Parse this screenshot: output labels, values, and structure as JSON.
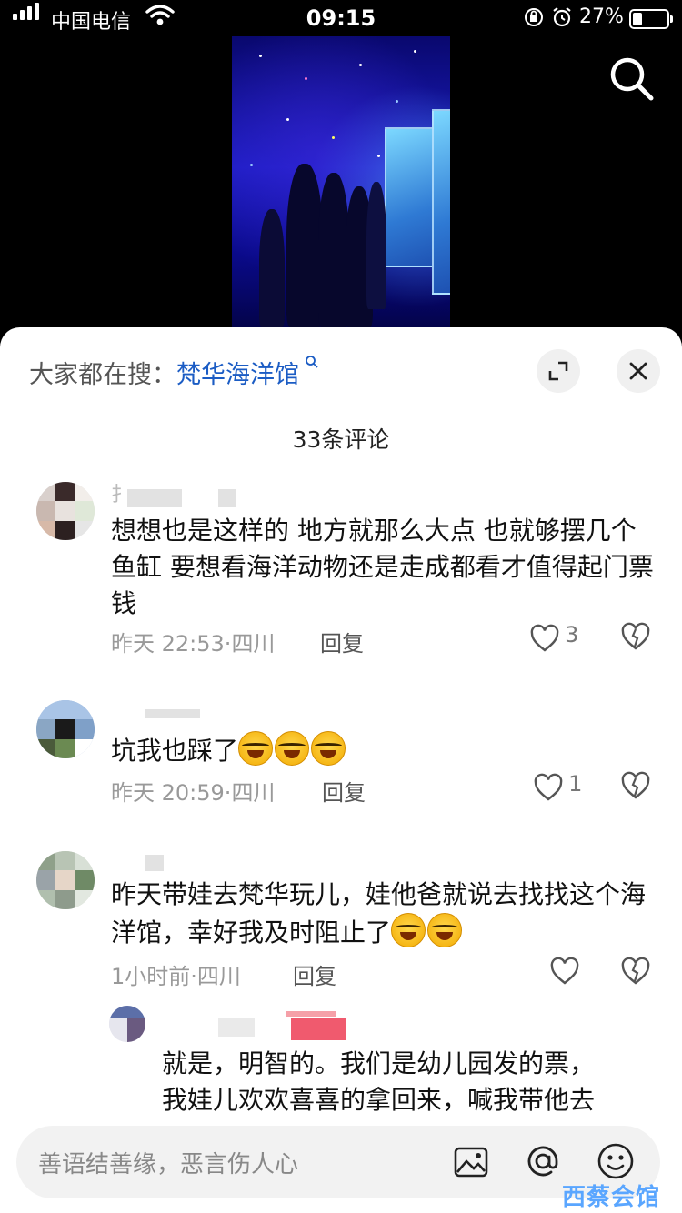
{
  "status_bar": {
    "carrier": "中国电信",
    "time": "09:15",
    "battery_percent": "27%"
  },
  "icons": {
    "search": "search-icon",
    "expand": "expand-icon",
    "close": "close-icon",
    "heart": "heart-icon",
    "dislike": "broken-heart-icon",
    "image": "image-icon",
    "mention": "at-icon",
    "emoji": "emoji-icon"
  },
  "panel": {
    "hot_search_prefix": "大家都在搜：",
    "hot_search_keyword": "梵华海洋馆",
    "comment_count_label": "33条评论"
  },
  "comments": [
    {
      "username_visible": "扌",
      "text": "想想也是这样的  地方就那么大点   也就够摆几个鱼缸  要想看海洋动物还是走成都看才值得起门票钱",
      "time": "昨天 22:53",
      "location": "四川",
      "reply_label": "回复",
      "likes": "3"
    },
    {
      "username_visible": "",
      "text": "坑我也踩了",
      "emoji_count": 3,
      "time": "昨天 20:59",
      "location": "四川",
      "reply_label": "回复",
      "likes": "1"
    },
    {
      "username_visible": "",
      "text": "昨天带娃去梵华玩儿，娃他爸就说去找找这个海洋馆，幸好我及时阻止了",
      "emoji_count": 2,
      "time": "1小时前",
      "location": "四川",
      "reply_label": "回复",
      "likes": ""
    },
    {
      "username_visible": "",
      "text_line1": "就是，明智的。我们是幼儿园发的票，",
      "text_line2": "我娃儿欢欢喜喜的拿回来，喊我带他去"
    }
  ],
  "input": {
    "placeholder": "善语结善缘，恶言伤人心"
  },
  "watermark": "西蔡会馆",
  "colors": {
    "link": "#1b5cc4",
    "watermark": "#5aa6ff"
  }
}
